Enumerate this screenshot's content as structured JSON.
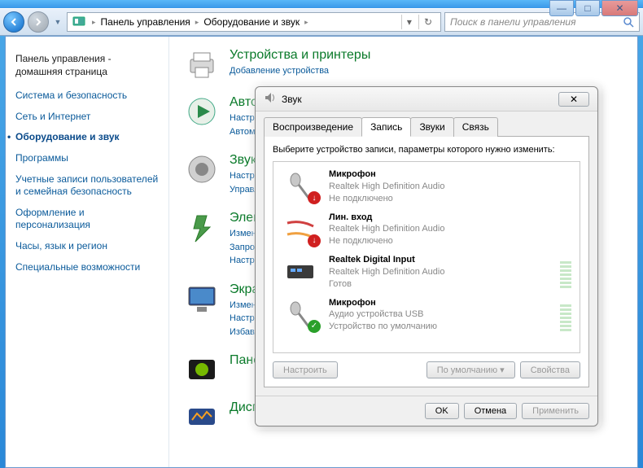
{
  "address": {
    "crumb1": "Панель управления",
    "crumb2": "Оборудование и звук"
  },
  "search": {
    "placeholder": "Поиск в панели управления"
  },
  "sidebar": {
    "header": "Панель управления - домашняя страница",
    "items": [
      "Система и безопасность",
      "Сеть и Интернет",
      "Оборудование и звук",
      "Программы",
      "Учетные записи пользователей и семейная безопасность",
      "Оформление и персонализация",
      "Часы, язык и регион",
      "Специальные возможности"
    ]
  },
  "main": {
    "cat1": {
      "title": "Устройства и принтеры",
      "sub1": "Добавление устройства"
    },
    "cat2": {
      "title": "Автозапуск",
      "sub1": "Настройка",
      "sub2": "Автоматическое"
    },
    "cat3": {
      "title": "Звук",
      "sub1": "Настройка",
      "sub2": "Управление"
    },
    "cat4": {
      "title": "Электропитание",
      "sub1": "Изменение",
      "sub2": "Запрос",
      "sub3": "Настройка"
    },
    "cat5": {
      "title": "Экран",
      "sub1": "Изменение",
      "sub2": "Настройка",
      "sub3": "Избавление"
    },
    "cat6": {
      "title": "Панель"
    },
    "cat7": {
      "title": "Диспетчер"
    }
  },
  "dialog": {
    "title": "Звук",
    "tabs": [
      "Воспроизведение",
      "Запись",
      "Звуки",
      "Связь"
    ],
    "instruction": "Выберите устройство записи, параметры которого нужно изменить:",
    "devices": [
      {
        "name": "Микрофон",
        "driver": "Realtek High Definition Audio",
        "status": "Не подключено",
        "badge": "down",
        "vu": false
      },
      {
        "name": "Лин. вход",
        "driver": "Realtek High Definition Audio",
        "status": "Не подключено",
        "badge": "down",
        "vu": false
      },
      {
        "name": "Realtek Digital Input",
        "driver": "Realtek High Definition Audio",
        "status": "Готов",
        "badge": "",
        "vu": true
      },
      {
        "name": "Микрофон",
        "driver": "Аудио устройства USB",
        "status": "Устройство по умолчанию",
        "badge": "ok",
        "vu": true
      }
    ],
    "btn_configure": "Настроить",
    "btn_default": "По умолчанию",
    "btn_properties": "Свойства",
    "btn_ok": "OK",
    "btn_cancel": "Отмена",
    "btn_apply": "Применить"
  }
}
